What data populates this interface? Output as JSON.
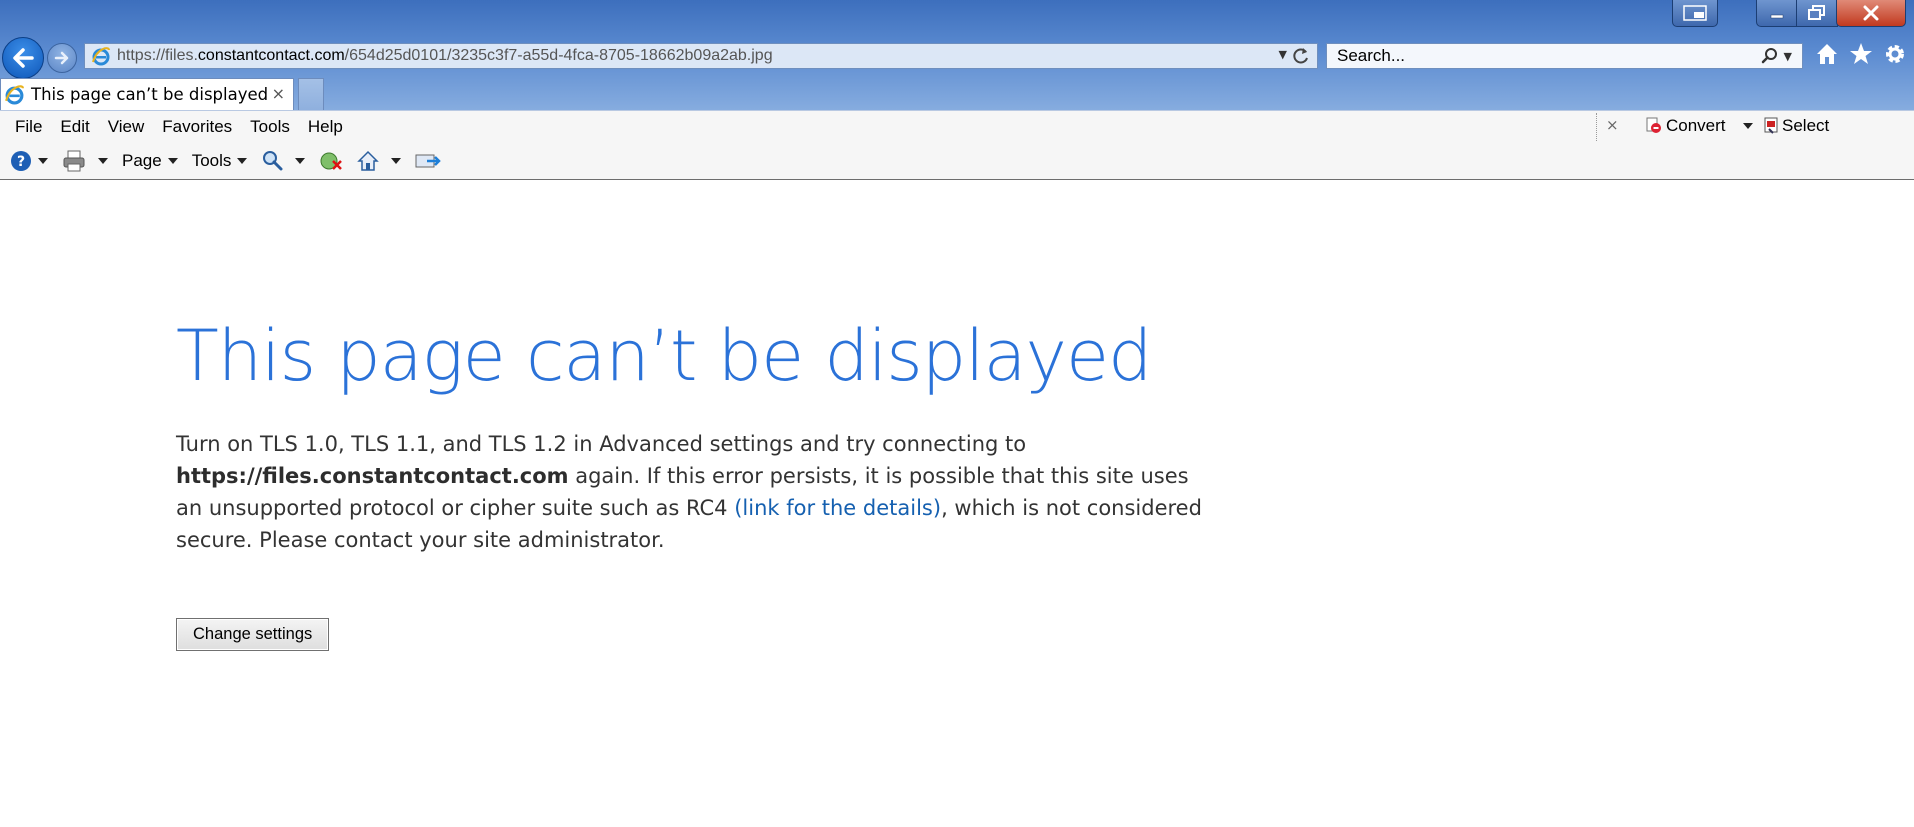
{
  "window": {
    "controls": [
      "pip-icon",
      "minimize-icon",
      "restore-icon",
      "close-icon"
    ]
  },
  "address_bar": {
    "url_prefix": "https://files.",
    "url_host": "constantcontact.com",
    "url_path": "/654d25d0101/3235c3f7-a55d-4fca-8705-18662b09a2ab.jpg"
  },
  "search": {
    "placeholder": "Search..."
  },
  "tab": {
    "title": "This page can’t be displayed",
    "close_glyph": "×"
  },
  "menu": {
    "items": [
      "File",
      "Edit",
      "View",
      "Favorites",
      "Tools",
      "Help"
    ]
  },
  "addon_bar": {
    "close_glyph": "×",
    "convert_label": "Convert",
    "select_label": "Select"
  },
  "command_bar": {
    "page_label": "Page",
    "tools_label": "Tools"
  },
  "error_page": {
    "title": "This page can’t be displayed",
    "msg_part1": "Turn on TLS 1.0, TLS 1.1, and TLS 1.2 in Advanced settings and try connecting to ",
    "site": "https://files.constantcontact.com",
    "msg_part2": " again. If this error persists, it is possible that this site uses an unsupported protocol or cipher suite such as RC4 ",
    "link_text": "(link for the details)",
    "msg_part3": ", which is not considered secure. Please contact your site administrator.",
    "button_label": "Change settings"
  },
  "colors": {
    "title_blue": "#2b72d8",
    "link_blue": "#1560b0",
    "chrome_blue": "#3d6fbd"
  }
}
